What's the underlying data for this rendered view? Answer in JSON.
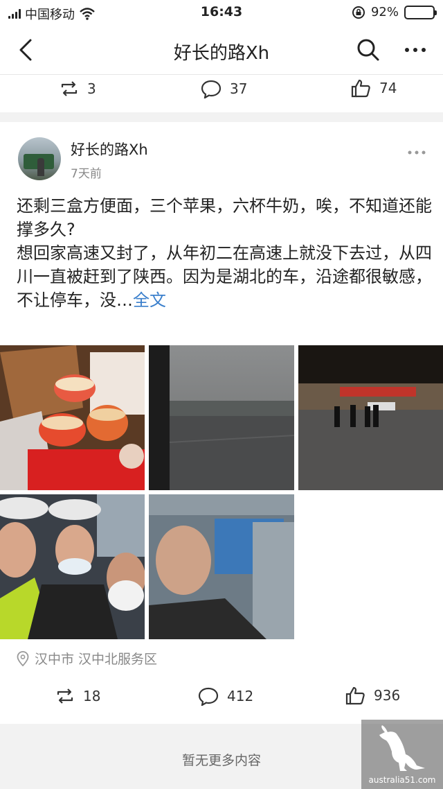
{
  "status": {
    "carrier": "中国移动",
    "time": "16:43",
    "battery_percent": "92%",
    "battery_level": 0.92
  },
  "nav": {
    "title": "好长的路Xh"
  },
  "prev_post": {
    "reposts": "3",
    "comments": "37",
    "likes": "74"
  },
  "post": {
    "username": "好长的路Xh",
    "time": "7天前",
    "line1": "还剩三盒方便面，三个苹果，六杯牛奶，唉，不知道还能撑多久?",
    "line2": "想回家高速又封了，从年初二在高速上就没下去过，从四川一直被赶到了陕西。因为是湖北的车，沿途都很敏感，不让停车，没…",
    "full_link": "全文",
    "location": "汉中市 汉中北服务区",
    "reposts": "18",
    "comments": "412",
    "likes": "936"
  },
  "footer": {
    "no_more": "暂无更多内容"
  },
  "watermark": {
    "text": "australia51.com"
  },
  "icons": {
    "back": "back-chevron-icon",
    "search": "search-icon",
    "more": "more-dots-icon",
    "repost": "repost-icon",
    "comment": "comment-icon",
    "like": "thumbs-up-icon",
    "location": "location-pin-icon",
    "wifi": "wifi-icon",
    "lock": "rotation-lock-icon"
  },
  "colors": {
    "link": "#3a7fcc",
    "battery": "#36c24a"
  }
}
